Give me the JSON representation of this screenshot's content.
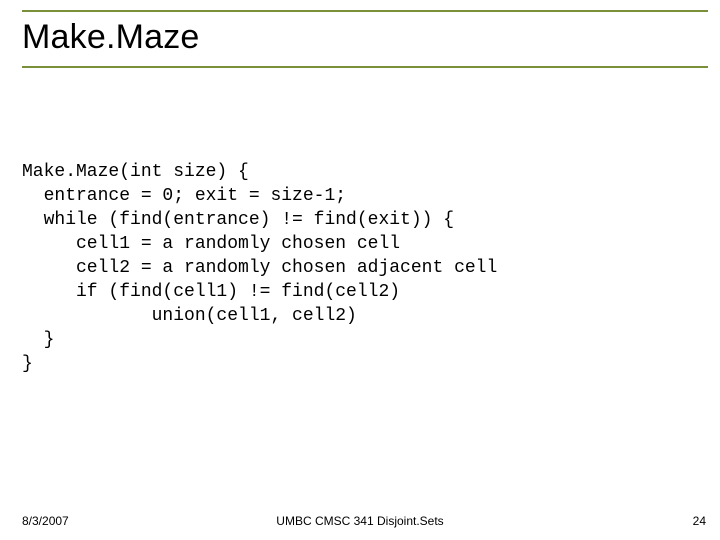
{
  "title": "Make.Maze",
  "code": "Make.Maze(int size) {\n  entrance = 0; exit = size-1;\n  while (find(entrance) != find(exit)) {\n     cell1 = a randomly chosen cell\n     cell2 = a randomly chosen adjacent cell\n     if (find(cell1) != find(cell2)\n            union(cell1, cell2)\n  }\n}",
  "footer": {
    "date": "8/3/2007",
    "center": "UMBC CMSC 341 Disjoint.Sets",
    "page": "24"
  }
}
